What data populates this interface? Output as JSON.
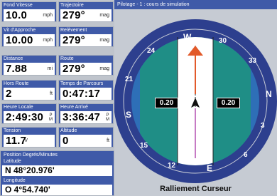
{
  "fields": [
    {
      "label": "Fond Vitesse",
      "value": "10.0",
      "unit": "mph"
    },
    {
      "label": "Trajectoire",
      "value": "279°",
      "unit": "mag"
    },
    {
      "label": "Vit d'Approche",
      "value": "10.00",
      "unit": "mph"
    },
    {
      "label": "Relèvement",
      "value": "279°",
      "unit": "mag"
    },
    {
      "label": "Distance",
      "value": "7.88",
      "unit": "mi"
    },
    {
      "label": "Route",
      "value": "279°",
      "unit": "mag"
    },
    {
      "label": "Hors Route",
      "value": "2",
      "unit": "ft"
    },
    {
      "label": "Temps de Parcours",
      "value": "0:47:17",
      "unit": ""
    },
    {
      "label": "Heure Locale",
      "value": "2:49:30",
      "unit_top": "P",
      "unit_bottom": "M"
    },
    {
      "label": "Heure Arrivé",
      "value": "3:36:47",
      "unit_top": "P",
      "unit_bottom": "M"
    },
    {
      "label": "Tension",
      "value": "11.7",
      "unit": "V"
    },
    {
      "label": "Altitude",
      "value": "0",
      "unit": "ft"
    }
  ],
  "position": {
    "header": "Position  Degrés/Minutes",
    "lat_label": "Latitude",
    "lat_value": "N   48°20.976'",
    "lon_label": "Longitude",
    "lon_value": "O     4°54.740'"
  },
  "pilotage": {
    "title": "Pilotage - 1 : cours de simulation",
    "left_value": "0.20",
    "right_value": "0.20",
    "caption": "Ralliement Curseur",
    "compass_labels": [
      "W",
      "30",
      "33",
      "N",
      "3",
      "6",
      "E",
      "12",
      "15",
      "S",
      "21",
      "24"
    ],
    "colors": {
      "ring": "#2d3f8e",
      "dial": "#2e6fb7",
      "teal": "#1f8e86",
      "arrow": "#e25a2a"
    }
  }
}
